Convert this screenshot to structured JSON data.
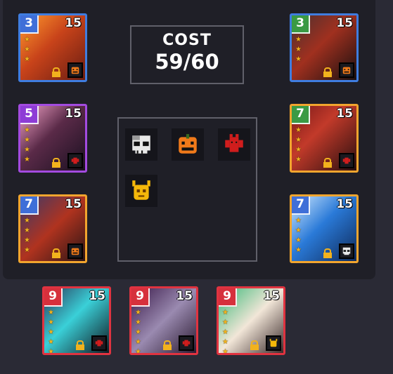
{
  "cost": {
    "title": "COST",
    "value": "59/60"
  },
  "colors": {
    "panel": "#1f1f27",
    "gold_star": "#f2b21d",
    "orange_trait": "#f07a1a",
    "red_trait": "#d01d1d",
    "yellow_trait": "#f5b80a",
    "skull_trait": "#e8e8e8"
  },
  "active_traits": [
    {
      "icon": "skull-icon"
    },
    {
      "icon": "pumpkin-icon"
    },
    {
      "icon": "bat-icon"
    },
    {
      "icon": "demon-icon"
    }
  ],
  "cards": [
    {
      "cost": "3",
      "level": "15",
      "trait_icon": "pumpkin-icon"
    },
    {
      "cost": "5",
      "level": "15",
      "trait_icon": "bat-icon"
    },
    {
      "cost": "7",
      "level": "15",
      "trait_icon": "pumpkin-icon"
    },
    {
      "cost": "3",
      "level": "15",
      "trait_icon": "pumpkin-icon"
    },
    {
      "cost": "7",
      "level": "15",
      "trait_icon": "bat-icon"
    },
    {
      "cost": "7",
      "level": "15",
      "trait_icon": "skull-icon"
    },
    {
      "cost": "9",
      "level": "15",
      "trait_icon": "bat-icon"
    },
    {
      "cost": "9",
      "level": "15",
      "trait_icon": "bat-icon"
    },
    {
      "cost": "9",
      "level": "15",
      "trait_icon": "demon-icon"
    }
  ]
}
